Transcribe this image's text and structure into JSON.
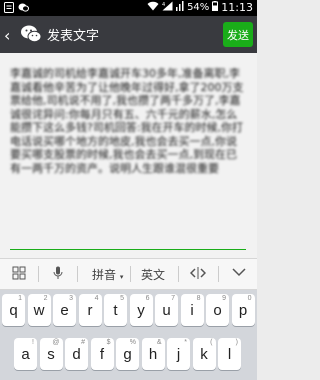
{
  "status_bar": {
    "battery": "54%",
    "time": "11:13"
  },
  "title_bar": {
    "back": "‹",
    "title": "发表文字",
    "send_label": "发送"
  },
  "editor": {
    "text": "李嘉诚的司机给李嘉诚开车30多年,准备离职,李嘉诚看他辛苦为了让他晚年过得好,拿了200万支票给他,司机说不用了,我也攒了两千多万了,李嘉诚很诧异问:你每月只有五、六千元的薪水,怎么能攒下这么多钱?司机回答:我在开车的时候,你打电话说买哪个地方的地皮,我也会去买一点,你说要买哪支股票的时候,我也会去买一点,到现在已有一两千万的资产。说明人生跟谁混很重要"
  },
  "keyboard_bar": {
    "grid_icon": "grid-icon",
    "mic_icon": "microphone-icon",
    "pinyin_label": "拼音",
    "english_label": "英文",
    "cursor_icon": "cursor-move-icon",
    "collapse_icon": "chevron-down-icon"
  },
  "keyboard": {
    "row1": [
      {
        "letter": "q",
        "digit": "1"
      },
      {
        "letter": "w",
        "digit": "2"
      },
      {
        "letter": "e",
        "digit": "3"
      },
      {
        "letter": "r",
        "digit": "4"
      },
      {
        "letter": "t",
        "digit": "5"
      },
      {
        "letter": "y",
        "digit": "6"
      },
      {
        "letter": "u",
        "digit": "7"
      },
      {
        "letter": "i",
        "digit": "8"
      },
      {
        "letter": "o",
        "digit": "9"
      },
      {
        "letter": "p",
        "digit": "0"
      }
    ],
    "row2": [
      {
        "letter": "a",
        "digit": "!"
      },
      {
        "letter": "s",
        "digit": "@"
      },
      {
        "letter": "d",
        "digit": "#"
      },
      {
        "letter": "f",
        "digit": "$"
      },
      {
        "letter": "g",
        "digit": "%"
      },
      {
        "letter": "h",
        "digit": "&"
      },
      {
        "letter": "j",
        "digit": "*"
      },
      {
        "letter": "k",
        "digit": "("
      },
      {
        "letter": "l",
        "digit": ")"
      }
    ]
  }
}
